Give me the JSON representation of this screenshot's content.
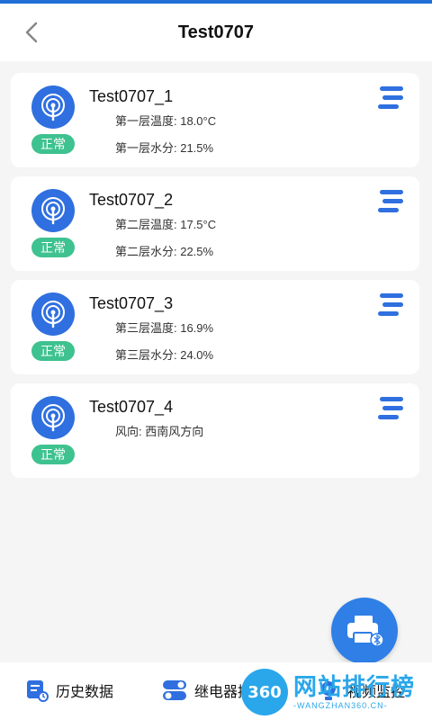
{
  "header": {
    "title": "Test0707"
  },
  "devices": [
    {
      "name": "Test0707_1",
      "status": "正常",
      "line1": "第一层温度: 18.0°C",
      "line2": "第一层水分: 21.5%"
    },
    {
      "name": "Test0707_2",
      "status": "正常",
      "line1": "第二层温度: 17.5°C",
      "line2": "第二层水分: 22.5%"
    },
    {
      "name": "Test0707_3",
      "status": "正常",
      "line1": "第三层温度: 16.9%",
      "line2": "第三层水分: 24.0%"
    },
    {
      "name": "Test0707_4",
      "status": "正常",
      "line1": "风向: 西南风方向",
      "line2": ""
    }
  ],
  "bottom_nav": {
    "history": "历史数据",
    "relay": "继电器控",
    "video": "视频监控"
  },
  "watermark": {
    "badge": "360",
    "main": "网站排行榜",
    "sub": "-WANGZHAN360.CN-"
  },
  "colors": {
    "accent": "#2f6fe0",
    "status_green": "#3ec28f",
    "fab": "#2f7fe6"
  }
}
